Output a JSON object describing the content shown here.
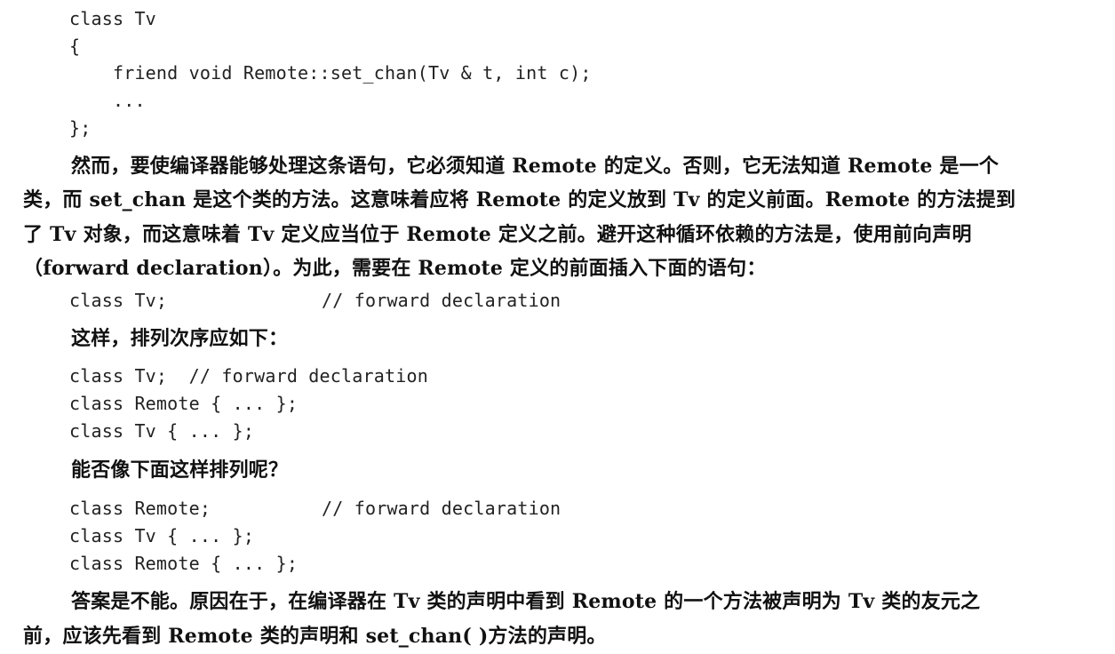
{
  "code_block_1": {
    "lines": [
      "class Tv",
      "{",
      "    friend void Remote::set_chan(Tv & t, int c);",
      "    ...",
      "};"
    ]
  },
  "paragraph_1": {
    "lines": [
      "然而，要使编译器能够处理这条语句，它必须知道 Remote 的定义。否则，它无法知道 Remote 是一个",
      "类，而 set_chan 是这个类的方法。这意味着应将 Remote 的定义放到 Tv 的定义前面。Remote 的方法提到",
      "了 Tv 对象，而这意味着 Tv 定义应当位于 Remote 定义之前。避开这种循环依赖的方法是，使用前向声明",
      "（forward declaration）。为此，需要在 Remote 定义的前面插入下面的语句："
    ]
  },
  "code_block_2": {
    "code": "class Tv;",
    "comment": "// forward declaration"
  },
  "paragraph_2": {
    "text": "这样，排列次序应如下："
  },
  "code_block_3": {
    "lines": [
      "class Tv;  // forward declaration",
      "class Remote { ... };",
      "class Tv { ... };"
    ]
  },
  "paragraph_3": {
    "text": "能否像下面这样排列呢？"
  },
  "code_block_4": {
    "line1_code": "class Remote;",
    "line1_comment": "// forward declaration",
    "line2": "class Tv { ... };",
    "line3": "class Remote { ... };"
  },
  "paragraph_4": {
    "lines": [
      "答案是不能。原因在于，在编译器在 Tv 类的声明中看到 Remote 的一个方法被声明为 Tv 类的友元之",
      "前，应该先看到 Remote 类的声明和 set_chan( )方法的声明。"
    ]
  }
}
